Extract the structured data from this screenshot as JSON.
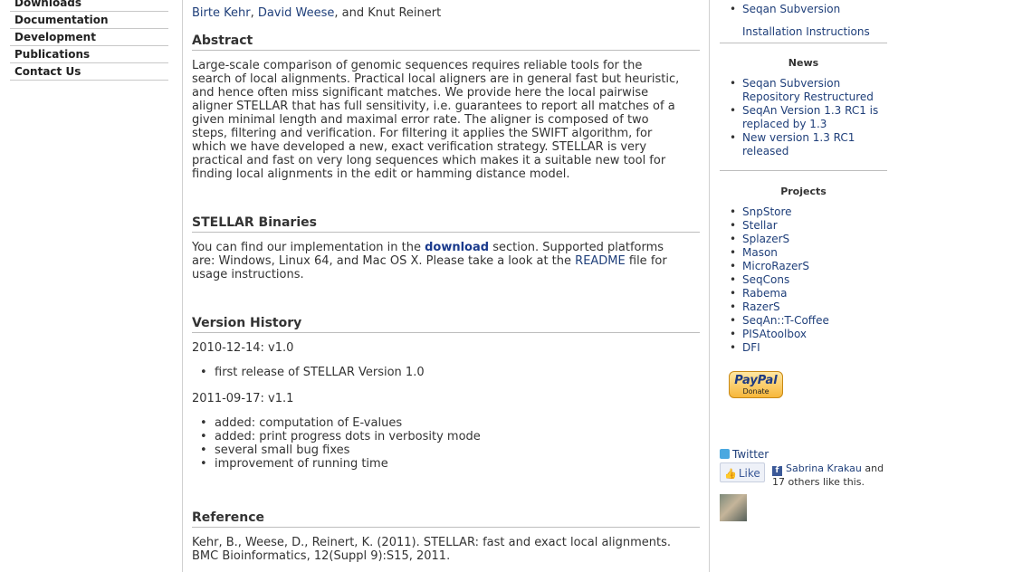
{
  "leftnav": {
    "items": [
      "Downloads",
      "Documentation",
      "Development",
      "Publications",
      "Contact Us"
    ]
  },
  "main": {
    "authors": {
      "a1": "Birte Kehr",
      "sep1": ", ",
      "a2": "David Weese",
      "sep2": ", and Knut Reinert"
    },
    "abstract": {
      "heading": "Abstract",
      "lines": [
        "Large-scale comparison of genomic sequences requires reliable tools for the",
        "search of local alignments. Practical local aligners are in general fast but heuristic,",
        "and hence often miss significant matches. We provide here the local pairwise",
        "aligner STELLAR that has full sensitivity, i.e. guarantees to report all matches of a",
        "given minimal length and maximal error rate. The aligner is composed of two",
        "steps, filtering and verification. For filtering it applies the SWIFT algorithm, for",
        "which we have developed a new, exact verification strategy. STELLAR is very",
        "practical and fast on very long sequences which makes it a suitable new tool for",
        "finding local alignments in the edit or hamming distance model."
      ]
    },
    "binaries": {
      "heading": "STELLAR Binaries",
      "l1_pre": "You can find our implementation in the ",
      "l1_link": "download",
      "l1_post": " section. Supported platforms",
      "l2_pre": "are: Windows, Linux 64, and Mac OS X. Please take a look at the ",
      "l2_link": "README",
      "l2_post": " file for",
      "l3": "usage instructions."
    },
    "history": {
      "heading": "Version History",
      "v1_date": "2010-12-14: v1.0",
      "v1_items": [
        "first release of STELLAR Version 1.0"
      ],
      "v2_date": "2011-09-17: v1.1",
      "v2_items": [
        "added: computation of E-values",
        "added: print progress dots in verbosity mode",
        "several small bug fixes",
        "improvement of running time"
      ]
    },
    "reference": {
      "heading": "Reference",
      "lines": [
        "Kehr, B., Weese, D., Reinert, K. (2011). STELLAR: fast and exact local alignments.",
        "BMC Bioinformatics, 12(Suppl 9):S15, 2011."
      ]
    }
  },
  "sidebar": {
    "top_link": "Seqan Subversion",
    "install_link": "Installation Instructions",
    "news_heading": "News",
    "news": [
      {
        "l1": "Seqan Subversion",
        "l2": "Repository Restructured"
      },
      {
        "l1": "SeqAn Version 1.3 RC1 is",
        "l2": "replaced by 1.3"
      },
      {
        "l1": "New version 1.3 RC1",
        "l2": "released"
      }
    ],
    "projects_heading": "Projects",
    "projects": [
      "SnpStore",
      "Stellar",
      "SplazerS",
      "Mason",
      "MicroRazerS",
      "SeqCons",
      "Rabema",
      "RazerS",
      "SeqAn::T-Coffee",
      "PISAtoolbox",
      "DFI"
    ],
    "paypal": {
      "logo": "PayPal",
      "donate": "Donate"
    },
    "twitter": "Twitter",
    "like_label": "Like",
    "fb_name": "Sabrina Krakau",
    "fb_rest1": " and",
    "fb_rest2": "17 others like this."
  }
}
